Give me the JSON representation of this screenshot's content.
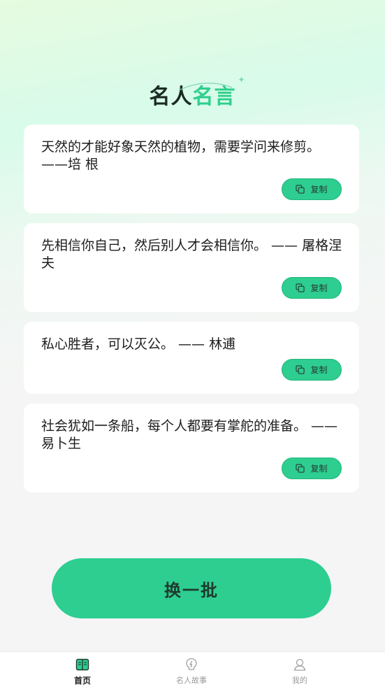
{
  "header": {
    "title_part1": "名人",
    "title_part2": "名言"
  },
  "quotes": [
    {
      "text": "天然的才能好象天然的植物，需要学问来修剪。 ——培 根",
      "copy_label": "复制"
    },
    {
      "text": "先相信你自己，然后别人才会相信你。 —— 屠格涅夫",
      "copy_label": "复制"
    },
    {
      "text": "私心胜者，可以灭公。 —— 林逋",
      "copy_label": "复制"
    },
    {
      "text": "社会犹如一条船，每个人都要有掌舵的准备。 —— 易卜生",
      "copy_label": "复制"
    }
  ],
  "actions": {
    "refresh_label": "换一批"
  },
  "tabbar": {
    "items": [
      {
        "label": "首页",
        "icon": "book-icon",
        "active": true
      },
      {
        "label": "名人故事",
        "icon": "lightning-bulb-icon",
        "active": false
      },
      {
        "label": "我的",
        "icon": "user-icon",
        "active": false
      }
    ]
  },
  "colors": {
    "accent": "#2dce90",
    "title_dark": "#1c2b24",
    "tab_active": "#1d1d1d",
    "tab_inactive": "#9a9a9a"
  }
}
